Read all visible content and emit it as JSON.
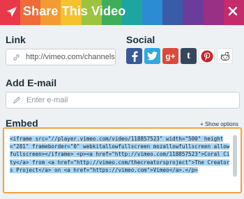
{
  "header": {
    "title": "Share This Video",
    "stripe_colors": [
      "#e8394b",
      "#f06a3a",
      "#f49a32",
      "#f5c12e",
      "#9cc43f",
      "#3fae5a",
      "#1fa5a0",
      "#2b8bd3",
      "#3a5ba8",
      "#6b3d9a",
      "#9a2f86",
      "#c42b6b"
    ]
  },
  "link": {
    "label": "Link",
    "value": "http://vimeo.com/channels/sta"
  },
  "social": {
    "label": "Social",
    "items": [
      "facebook-icon",
      "twitter-icon",
      "google-plus-icon",
      "tumblr-icon",
      "pinterest-icon",
      "reddit-icon"
    ]
  },
  "email": {
    "label": "Add E-mail",
    "placeholder": "Enter e-mail"
  },
  "embed": {
    "label": "Embed",
    "show_options": "+ Show options",
    "code": "<iframe src=\"//player.vimeo.com/video/118857523\" width=\"500\" height=\"281\" frameborder=\"0\" webkitallowfullscreen mozallowfullscreen allowfullscreen></iframe> <p><a href=\"http://vimeo.com/118857523\">Coral City</a> from <a href=\"http://vimeo.com/thecreatorsproject\">The Creators Project</a> on <a href=\"https://vimeo.com\">Vimeo</a>.</p>"
  },
  "colors": {
    "accent": "#f0a23c",
    "selection": "#a9d6f7"
  }
}
